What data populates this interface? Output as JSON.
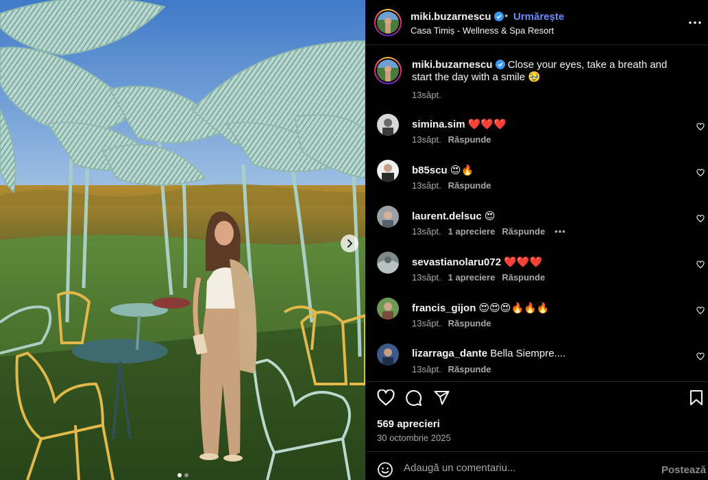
{
  "post": {
    "username": "miki.buzarnescu",
    "follow_label": "Urmărește",
    "separator": "•",
    "location": "Casa Timiș - Wellness & Spa Resort",
    "caption_text": "Close your eyes, take a breath and start the day with a smile 🥹",
    "caption_time": "13săpt.",
    "likes_text": "569 aprecieri",
    "date_text": "30 octombrie 2025",
    "carousel": {
      "slide_count": 2,
      "active_slide": 1
    }
  },
  "comments": [
    {
      "username": "simina.sim",
      "text": "❤️❤️❤️",
      "time": "13săpt.",
      "likes": "",
      "reply": "Răspunde",
      "more": ""
    },
    {
      "username": "b85scu",
      "text": "😍🔥",
      "time": "13săpt.",
      "likes": "",
      "reply": "Răspunde",
      "more": ""
    },
    {
      "username": "laurent.delsuc",
      "text": "😍",
      "time": "13săpt.",
      "likes": "1 apreciere",
      "reply": "Răspunde",
      "more": "•••"
    },
    {
      "username": "sevastianolaru072",
      "text": "❤️❤️❤️",
      "time": "13săpt.",
      "likes": "1 apreciere",
      "reply": "Răspunde",
      "more": ""
    },
    {
      "username": "francis_gijon",
      "text": "😍😍😍🔥🔥🔥",
      "time": "13săpt.",
      "likes": "",
      "reply": "Răspunde",
      "more": ""
    },
    {
      "username": "lizarraga_dante",
      "text": "Bella Siempre....",
      "time": "13săpt.",
      "likes": "",
      "reply": "Răspunde",
      "more": ""
    }
  ],
  "compose": {
    "placeholder": "Adaugă un comentariu...",
    "post_label": "Postează"
  },
  "icons": {
    "verified": "verified-badge-icon",
    "more": "more-options-icon",
    "like": "heart-icon",
    "comment": "comment-bubble-icon",
    "share": "paper-plane-icon",
    "save": "bookmark-icon",
    "emoji": "emoji-icon",
    "next": "chevron-right-icon"
  },
  "colors": {
    "background": "#000000",
    "text": "#f5f5f5",
    "secondary": "#a8a8a8",
    "follow": "#6b8cff",
    "verified": "#3897f0",
    "divider": "#262626"
  }
}
